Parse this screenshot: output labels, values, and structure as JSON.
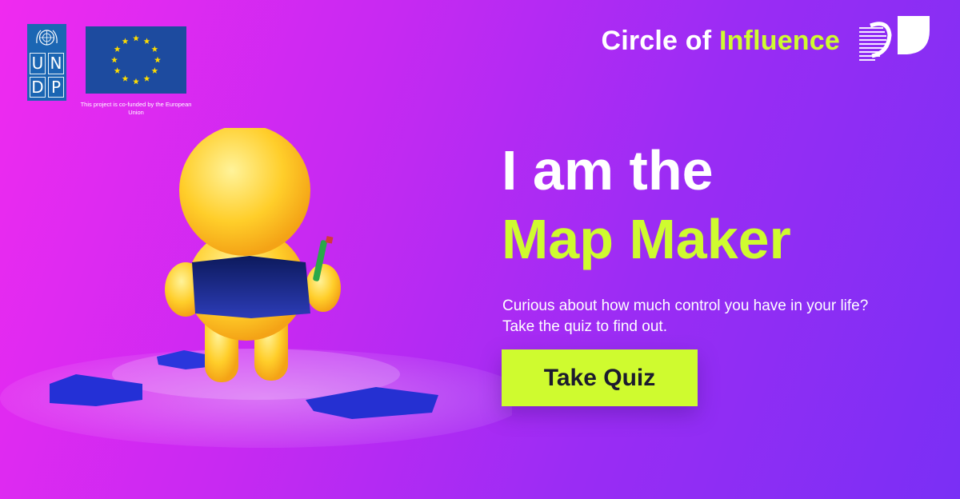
{
  "undp_logo": {
    "letters": [
      "U",
      "N",
      "D",
      "P"
    ]
  },
  "eu": {
    "caption": "This project is co-funded by the European Union"
  },
  "header": {
    "brand_prefix": "Circle of ",
    "brand_accent": "Influence"
  },
  "hero": {
    "title_line1": "I am the",
    "title_line2": "Map Maker",
    "description": "Curious about how much control you have in your life? Take the quiz to find out.",
    "cta_label": "Take Quiz"
  },
  "colors": {
    "accent": "#cffb2f",
    "background_start": "#f02af0",
    "background_end": "#7a2ff5",
    "undp_blue": "#1b66b3",
    "eu_blue": "#1d4b9f",
    "eu_star": "#ffdd00",
    "character": "#ffc21f"
  },
  "icons": {
    "undp": "un-emblem-icon",
    "eu": "eu-flag-icon",
    "brand": "brand-mark-icon"
  }
}
